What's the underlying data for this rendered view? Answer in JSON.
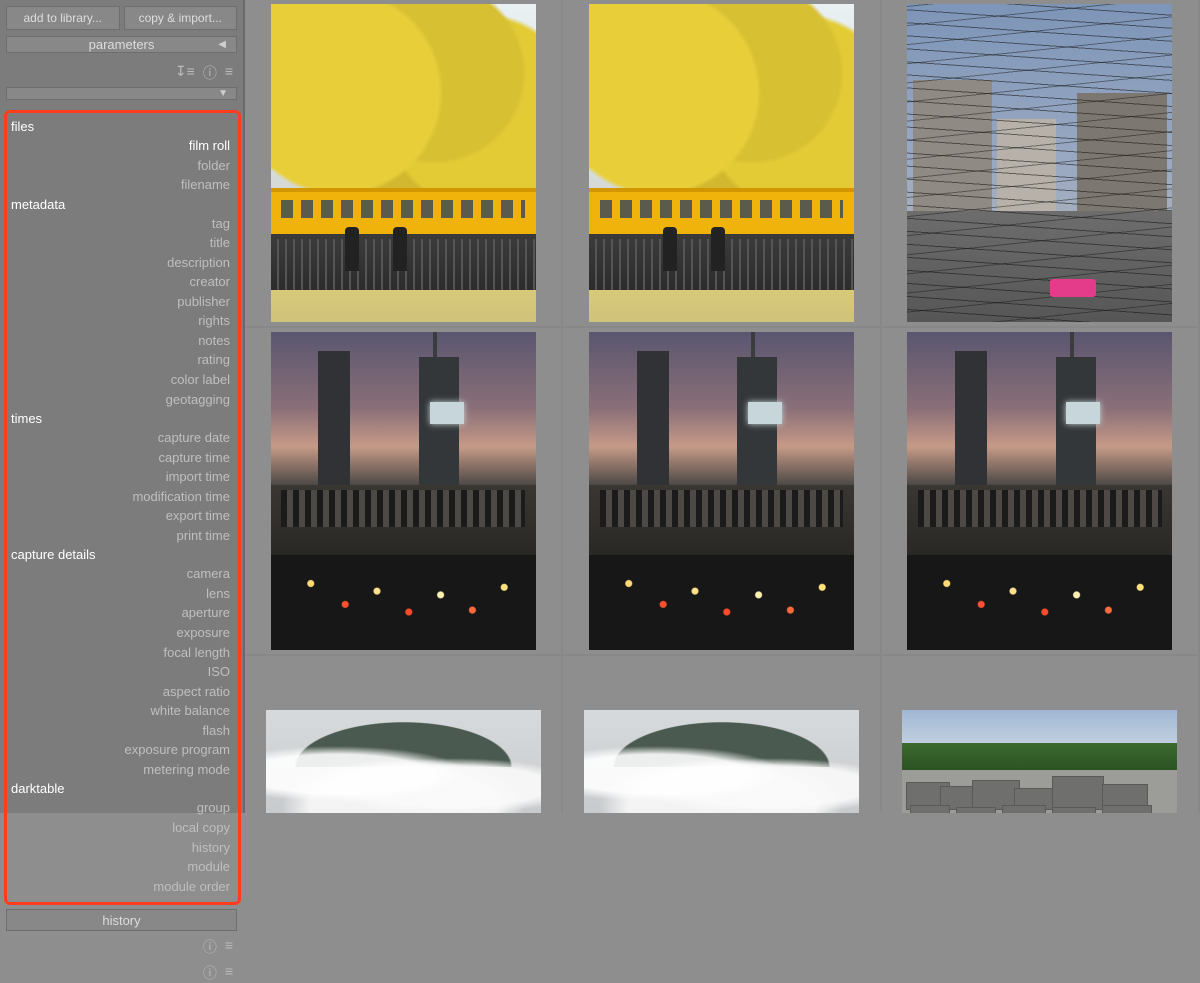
{
  "topbar": {
    "add_library": "add to library...",
    "copy_import": "copy & import...",
    "parameters": "parameters"
  },
  "history_label": "history",
  "collections": {
    "groups": [
      {
        "title": "files",
        "items": [
          {
            "label": "film roll",
            "active": true
          },
          {
            "label": "folder"
          },
          {
            "label": "filename"
          }
        ]
      },
      {
        "title": "metadata",
        "items": [
          {
            "label": "tag"
          },
          {
            "label": "title"
          },
          {
            "label": "description"
          },
          {
            "label": "creator"
          },
          {
            "label": "publisher"
          },
          {
            "label": "rights"
          },
          {
            "label": "notes"
          },
          {
            "label": "rating"
          },
          {
            "label": "color label"
          },
          {
            "label": "geotagging"
          }
        ]
      },
      {
        "title": "times",
        "items": [
          {
            "label": "capture date"
          },
          {
            "label": "capture time"
          },
          {
            "label": "import time"
          },
          {
            "label": "modification time"
          },
          {
            "label": "export time"
          },
          {
            "label": "print time"
          }
        ]
      },
      {
        "title": "capture details",
        "items": [
          {
            "label": "camera"
          },
          {
            "label": "lens"
          },
          {
            "label": "aperture"
          },
          {
            "label": "exposure"
          },
          {
            "label": "focal length"
          },
          {
            "label": "ISO"
          },
          {
            "label": "aspect ratio"
          },
          {
            "label": "white balance"
          },
          {
            "label": "flash"
          },
          {
            "label": "exposure program"
          },
          {
            "label": "metering mode"
          }
        ]
      },
      {
        "title": "darktable",
        "items": [
          {
            "label": "group"
          },
          {
            "label": "local copy"
          },
          {
            "label": "history"
          },
          {
            "label": "module"
          },
          {
            "label": "module order"
          }
        ]
      }
    ]
  },
  "thumbnails": [
    [
      {
        "kind": "ginkgo"
      },
      {
        "kind": "ginkgo"
      },
      {
        "kind": "street"
      }
    ],
    [
      {
        "kind": "dusk"
      },
      {
        "kind": "dusk"
      },
      {
        "kind": "dusk"
      }
    ],
    [
      {
        "kind": "clouds"
      },
      {
        "kind": "clouds"
      },
      {
        "kind": "memorial"
      }
    ]
  ]
}
